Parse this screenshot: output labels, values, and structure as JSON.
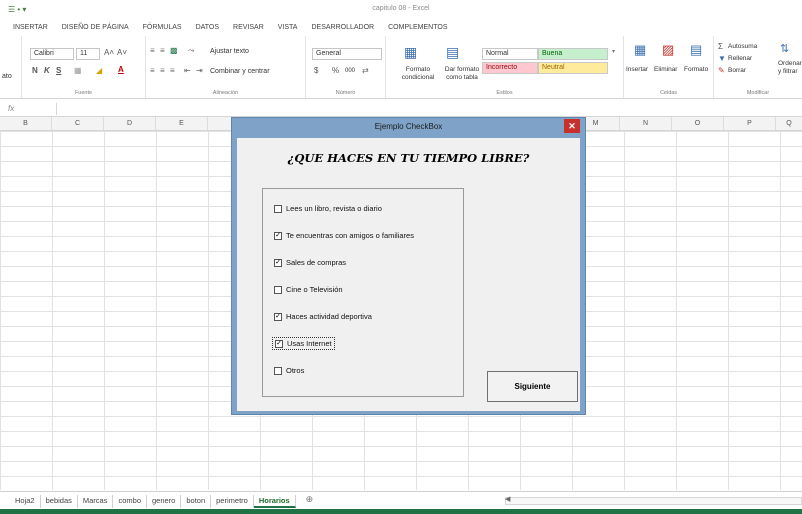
{
  "window": {
    "title": "capitulo 08 - Excel",
    "quick_access": "☰ • ▾"
  },
  "ribbon_tabs": [
    "INSERTAR",
    "DISEÑO DE PÁGINA",
    "FÓRMULAS",
    "DATOS",
    "REVISAR",
    "VISTA",
    "DESARROLLADOR",
    "COMPLEMENTOS"
  ],
  "ribbon": {
    "font": {
      "name": "Calibri",
      "size": "11",
      "grow": "A˄",
      "shrink": "A˅",
      "bold": "N",
      "italic": "K",
      "underline": "S",
      "label": "Fuente"
    },
    "clip_label": "ato",
    "alignment": {
      "wrap": "Ajustar texto",
      "merge": "Combinar y centrar",
      "label": "Alineación"
    },
    "number": {
      "format": "General",
      "currency": "$",
      "percent": "%",
      "thousands": "000",
      "label": "Número"
    },
    "styles": {
      "conditional": "Formato condicional",
      "as_table": "Dar formato como tabla",
      "cells": [
        {
          "name": "Normal",
          "color": "#ffffff"
        },
        {
          "name": "Buena",
          "color": "#c6efce"
        },
        {
          "name": "Incorrecto",
          "color": "#ffc7ce"
        },
        {
          "name": "Neutral",
          "color": "#ffeb9c"
        }
      ],
      "label": "Estilos"
    },
    "cells": {
      "insert": "Insertar",
      "delete": "Eliminar",
      "format": "Formato",
      "label": "Celdas"
    },
    "editing": {
      "autosum": "Autosuma",
      "fill": "Rellenar",
      "clear": "Borrar",
      "sort": "Ordenar y filtrar",
      "label": "Modificar"
    }
  },
  "formula_bar": {
    "fx": "fx",
    "value": ""
  },
  "columns": [
    "B",
    "C",
    "D",
    "E",
    "F",
    "G",
    "H",
    "I",
    "J",
    "K",
    "L",
    "M",
    "N",
    "O",
    "P",
    "Q"
  ],
  "sheets": {
    "tabs": [
      "Hoja2",
      "bebidas",
      "Marcas",
      "combo",
      "genero",
      "boton",
      "perimetro",
      "Horarios"
    ],
    "active": "Horarios",
    "add": "⊕"
  },
  "dialog": {
    "title": "Ejemplo  CheckBox",
    "close": "✕",
    "heading": "¿QUE HACES EN TU TIEMPO LIBRE?",
    "options": [
      {
        "label": "Lees un libro, revista o diario",
        "checked": false,
        "mark": ""
      },
      {
        "label": "Te encuentras con amigos o familiares",
        "checked": true,
        "mark": "✓"
      },
      {
        "label": "Sales de compras",
        "checked": true,
        "mark": "✓"
      },
      {
        "label": "Cine o Televisión",
        "checked": false,
        "mark": ""
      },
      {
        "label": "Haces actividad deportiva",
        "checked": true,
        "mark": "✓"
      },
      {
        "label": "Usas Internet",
        "checked": true,
        "mark": "✓"
      },
      {
        "label": "Otros",
        "checked": false,
        "mark": ""
      }
    ],
    "next_button": "Siguiente"
  },
  "colors": {
    "excel_green": "#217346",
    "dialog_frame": "#7fa3c8",
    "close_red": "#c9302c"
  }
}
